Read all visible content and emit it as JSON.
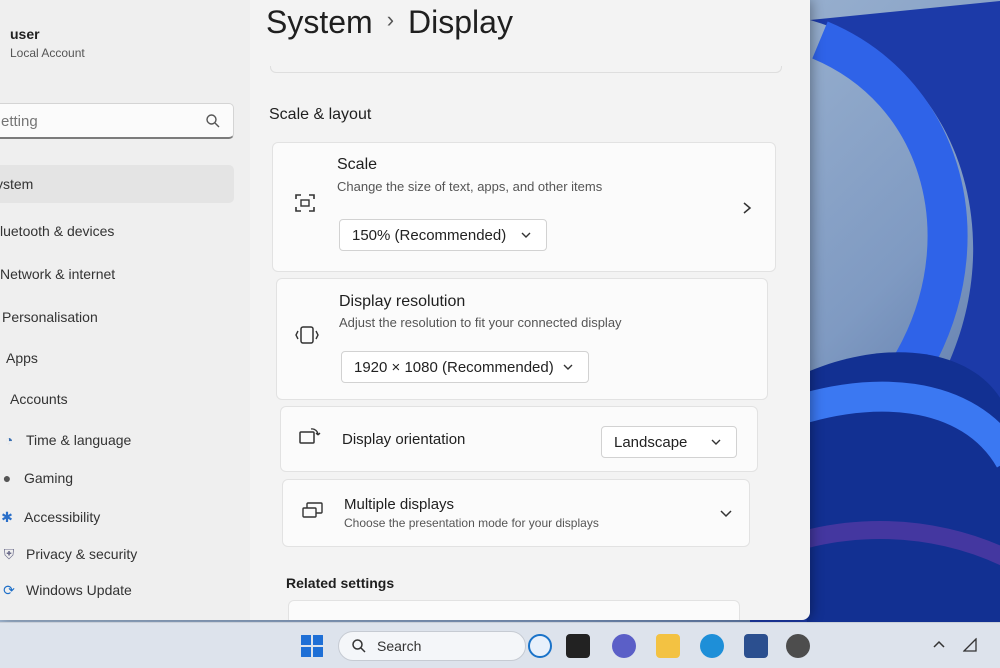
{
  "account": {
    "name": "user",
    "type": "Local Account"
  },
  "search": {
    "placeholder": "etting"
  },
  "nav": {
    "items": [
      {
        "label": "ystem",
        "icon": "system-icon"
      },
      {
        "label": "luetooth & devices",
        "icon": "bluetooth-icon"
      },
      {
        "label": "Network & internet",
        "icon": "network-icon"
      },
      {
        "label": "Personalisation",
        "icon": "personalisation-icon"
      },
      {
        "label": "Apps",
        "icon": "apps-icon"
      },
      {
        "label": "Accounts",
        "icon": "accounts-icon"
      },
      {
        "label": "Time & language",
        "icon": "time-language-icon"
      },
      {
        "label": "Gaming",
        "icon": "gaming-icon"
      },
      {
        "label": "Accessibility",
        "icon": "accessibility-icon"
      },
      {
        "label": "Privacy & security",
        "icon": "privacy-shield-icon"
      },
      {
        "label": "Windows Update",
        "icon": "windows-update-icon"
      }
    ]
  },
  "breadcrumb": {
    "parent": "System",
    "separator": "›",
    "current": "Display"
  },
  "sections": {
    "scale_layout": "Scale & layout",
    "related": "Related settings"
  },
  "cards": {
    "scale": {
      "title": "Scale",
      "desc": "Change the size of text, apps, and other items",
      "value": "150% (Recommended)"
    },
    "resolution": {
      "title": "Display resolution",
      "desc": "Adjust the resolution to fit your connected display",
      "value": "1920 × 1080 (Recommended)"
    },
    "orientation": {
      "title": "Display orientation",
      "value": "Landscape"
    },
    "multiple": {
      "title": "Multiple displays",
      "desc": "Choose the presentation mode for your displays"
    }
  },
  "taskbar": {
    "search_label": "Search"
  },
  "colors": {
    "accent": "#0067c0",
    "window_bg": "#f3f3f3",
    "card_bg": "#fbfbfb"
  }
}
